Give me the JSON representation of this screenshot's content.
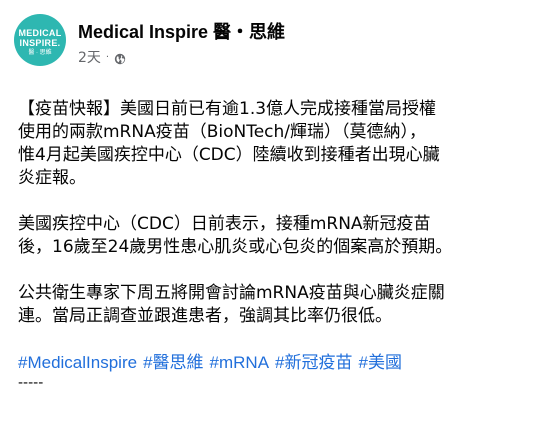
{
  "header": {
    "avatar": {
      "line1": "MEDICAL",
      "line2": "INSPIRE.",
      "line3": "醫 · 思維",
      "bg_color": "#2eb7b1"
    },
    "page_name": "Medical Inspire 醫・思維",
    "timestamp": "2天",
    "separator": "·",
    "privacy_icon": "globe-icon"
  },
  "post": {
    "paragraphs": [
      [
        "【疫苗快報】美國日前已有逾1.3億人完成接種當局授權",
        "使用的兩款mRNA疫苗（BioNTech/輝瑞）（莫德納），",
        "惟4月起美國疾控中心（CDC）陸續收到接種者出現心臟",
        "炎症報。"
      ],
      [
        "美國疾控中心（CDC）日前表示，接種mRNA新冠疫苗",
        "後，16歲至24歲男性患心肌炎或心包炎的個案高於預期。"
      ],
      [
        "公共衛生專家下周五將開會討論mRNA疫苗與心臟炎症關",
        "連。當局正調查並跟進患者，強調其比率仍很低。"
      ]
    ],
    "hashtags": [
      "#MedicalInspire",
      "#醫思維",
      "#mRNA",
      "#新冠疫苗",
      "#美國"
    ],
    "trailing_text": "-----",
    "link_color": "#216fdb"
  }
}
